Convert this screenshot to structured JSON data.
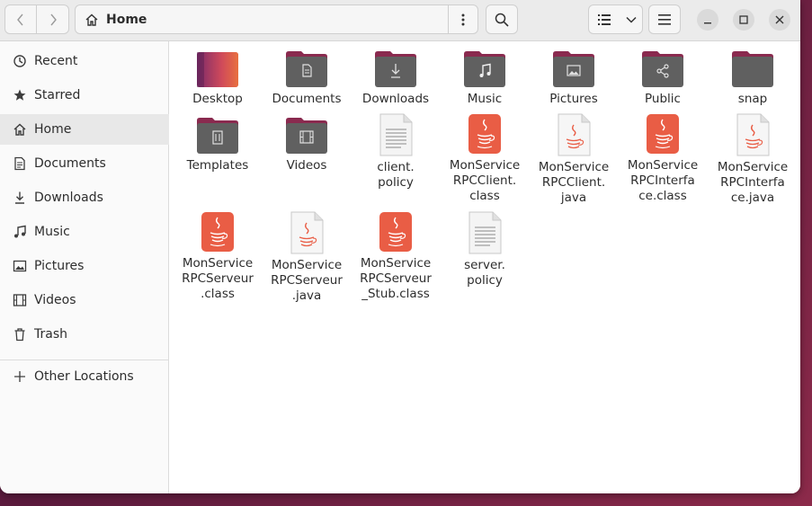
{
  "header": {
    "location": "Home"
  },
  "sidebar": {
    "items": [
      {
        "label": "Recent",
        "icon": "clock-icon"
      },
      {
        "label": "Starred",
        "icon": "star-icon"
      },
      {
        "label": "Home",
        "icon": "home-icon"
      },
      {
        "label": "Documents",
        "icon": "document-icon"
      },
      {
        "label": "Downloads",
        "icon": "download-icon"
      },
      {
        "label": "Music",
        "icon": "music-icon"
      },
      {
        "label": "Pictures",
        "icon": "picture-icon"
      },
      {
        "label": "Videos",
        "icon": "video-icon"
      },
      {
        "label": "Trash",
        "icon": "trash-icon"
      }
    ],
    "other_locations": "Other Locations",
    "active": "Home"
  },
  "files": [
    {
      "name": "Desktop",
      "kind": "folder-desktop"
    },
    {
      "name": "Documents",
      "kind": "folder-documents"
    },
    {
      "name": "Downloads",
      "kind": "folder-downloads"
    },
    {
      "name": "Music",
      "kind": "folder-music"
    },
    {
      "name": "Pictures",
      "kind": "folder-pictures"
    },
    {
      "name": "Public",
      "kind": "folder-public"
    },
    {
      "name": "snap",
      "kind": "folder"
    },
    {
      "name": "Templates",
      "kind": "folder-templates"
    },
    {
      "name": "Videos",
      "kind": "folder-videos"
    },
    {
      "name": "client.\npolicy",
      "kind": "text"
    },
    {
      "name": "MonService\nRPCClient.\nclass",
      "kind": "java-class"
    },
    {
      "name": "MonService\nRPCClient.\njava",
      "kind": "java-source"
    },
    {
      "name": "MonService\nRPCInterfa\nce.class",
      "kind": "java-class"
    },
    {
      "name": "MonService\nRPCInterfa\nce.java",
      "kind": "java-source"
    },
    {
      "name": "MonService\nRPCServeur\n.class",
      "kind": "java-class"
    },
    {
      "name": "MonService\nRPCServeur\n.java",
      "kind": "java-source"
    },
    {
      "name": "MonService\nRPCServeur\n_Stub.class",
      "kind": "java-class"
    },
    {
      "name": "server.\npolicy",
      "kind": "text"
    }
  ],
  "colors": {
    "folder_tab": "#8a2a4f",
    "folder_body": "#5f5f5f",
    "java_class": "#e95d45",
    "accent": "#e95420"
  }
}
